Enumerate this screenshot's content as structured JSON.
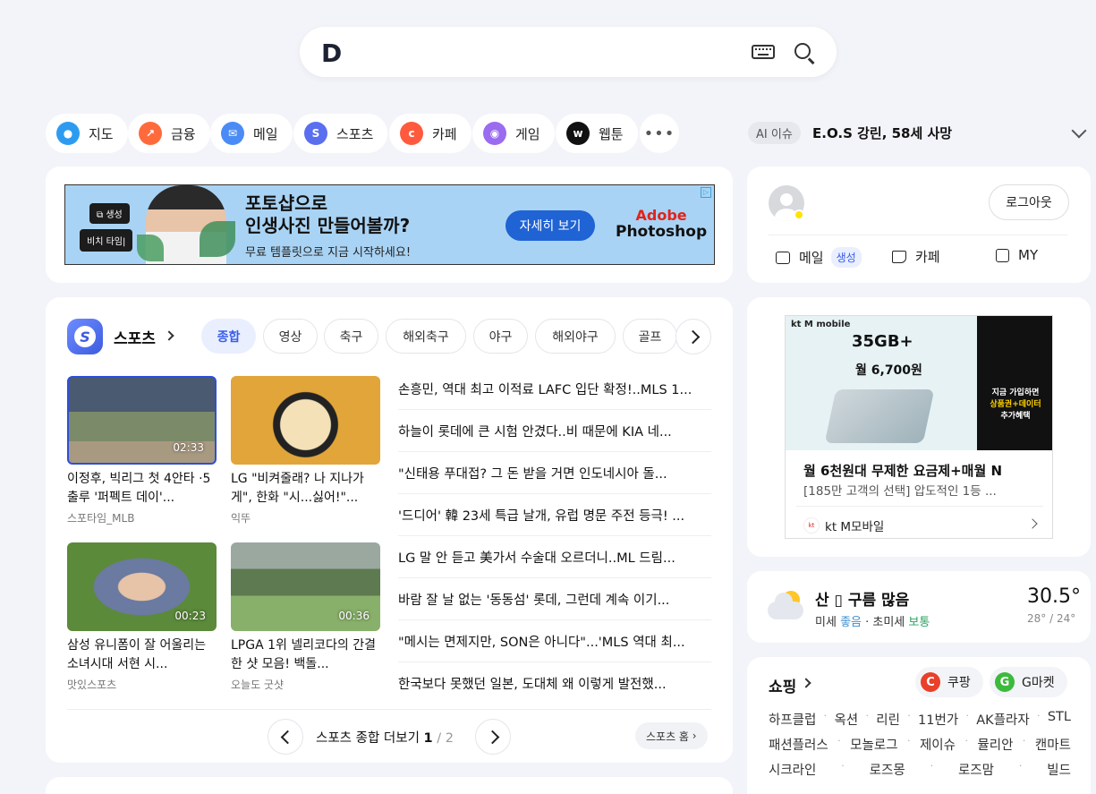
{
  "search": {
    "logo": "D"
  },
  "services": [
    {
      "label": "지도",
      "color": "#2d9cf0"
    },
    {
      "label": "금융",
      "color": "#ff6a3d"
    },
    {
      "label": "메일",
      "color": "#4b8bf5"
    },
    {
      "label": "스포츠",
      "color": "#5a6ef0"
    },
    {
      "label": "카페",
      "color": "#ff5a3d"
    },
    {
      "label": "게임",
      "color": "#9b6bf0"
    },
    {
      "label": "웹툰",
      "color": "#111111"
    }
  ],
  "ai_issue": {
    "badge": "AI 이슈",
    "text": "E.O.S 강린, 58세 사망"
  },
  "ad_banner": {
    "tag1": "생성",
    "tag2": "비치 타임|",
    "headline1": "포토샵으로",
    "headline2": "인생사진 만들어볼까?",
    "subtext": "무료 템플릿으로 지금 시작하세요!",
    "button": "자세히 보기",
    "brand1": "Adobe",
    "brand2": "Photoshop"
  },
  "sports": {
    "title": "스포츠",
    "tabs": [
      "종합",
      "영상",
      "축구",
      "해외축구",
      "야구",
      "해외야구",
      "골프"
    ],
    "videos": [
      {
        "title": "이정후, 빅리그 첫 4안타 ·5출루 '퍼펙트 데이'...",
        "source": "스포타임_MLB",
        "duration": "02:33"
      },
      {
        "title": "LG \"비켜줄래? 나 지나가게\", 한화 \"시...싫어!\"...",
        "source": "익뚜",
        "duration": ""
      },
      {
        "title": "삼성 유니폼이 잘 어울리는 소녀시대 서현 시...",
        "source": "맛있스포츠",
        "duration": "00:23"
      },
      {
        "title": "LPGA 1위 넬리코다의 간결한 샷 모음! 백돌...",
        "source": "오늘도 굿샷",
        "duration": "00:36"
      }
    ],
    "news": [
      "손흥민, 역대 최고 이적료 LAFC 입단 확정!..MLS 1...",
      "하늘이 롯데에 큰 시험 안겼다..비 때문에 KIA 네...",
      "\"신태용 푸대접? 그 돈 받을 거면 인도네시아 돌...",
      "'드디어' 韓 23세 특급 날개, 유럽 명문 주전 등극! ...",
      "LG 말 안 듣고 美가서 수술대 오르더니..ML 드림...",
      "바람 잘 날 없는 '동동섬' 롯데, 그런데 계속 이기...",
      "\"메시는 면제지만, SON은 아니다\"...'MLS 역대 최...",
      "한국보다 못했던 일본, 도대체 왜 이렇게 발전했..."
    ],
    "more_label": "스포츠 종합 더보기",
    "page_current": "1",
    "page_sep": "/",
    "page_total": "2",
    "home_label": "스포츠 홈"
  },
  "account": {
    "logout": "로그아웃",
    "mail": "메일",
    "mail_badge": "생성",
    "cafe": "카페",
    "my": "MY"
  },
  "ad_side": {
    "brand": "kt M mobile",
    "data": "35GB+",
    "price": "월 6,700원",
    "dark_line1": "지금 가입하면",
    "dark_line2": "상품권+데이터",
    "dark_line3": "추가혜택",
    "title": "월 6천원대 무제한 요금제+매월 N",
    "desc": "[185만 고객의 선택] 압도적인 1등 ...",
    "advertiser": "kt M모바일"
  },
  "weather": {
    "title": "산 ▯ 구름 많음",
    "dust_label": "미세",
    "dust_value": "좋음",
    "fine_label": "초미세",
    "fine_value": "보통",
    "temp": "30.5°",
    "range": "28° / 24°"
  },
  "shopping": {
    "title": "쇼핑",
    "partners": [
      {
        "label": "쿠팡",
        "icon": "C",
        "color": "#e8402a"
      },
      {
        "label": "G마켓",
        "icon": "G",
        "color": "#3cba3c"
      }
    ],
    "rows": [
      [
        "하프클럽",
        "옥션",
        "리린",
        "11번가",
        "AK플라자",
        "STL"
      ],
      [
        "패션플러스",
        "모놀로그",
        "제이슈",
        "뮬리안",
        "캔마트"
      ],
      [
        "시크라인",
        "로즈몽",
        "로즈맘",
        "빌드"
      ]
    ]
  }
}
